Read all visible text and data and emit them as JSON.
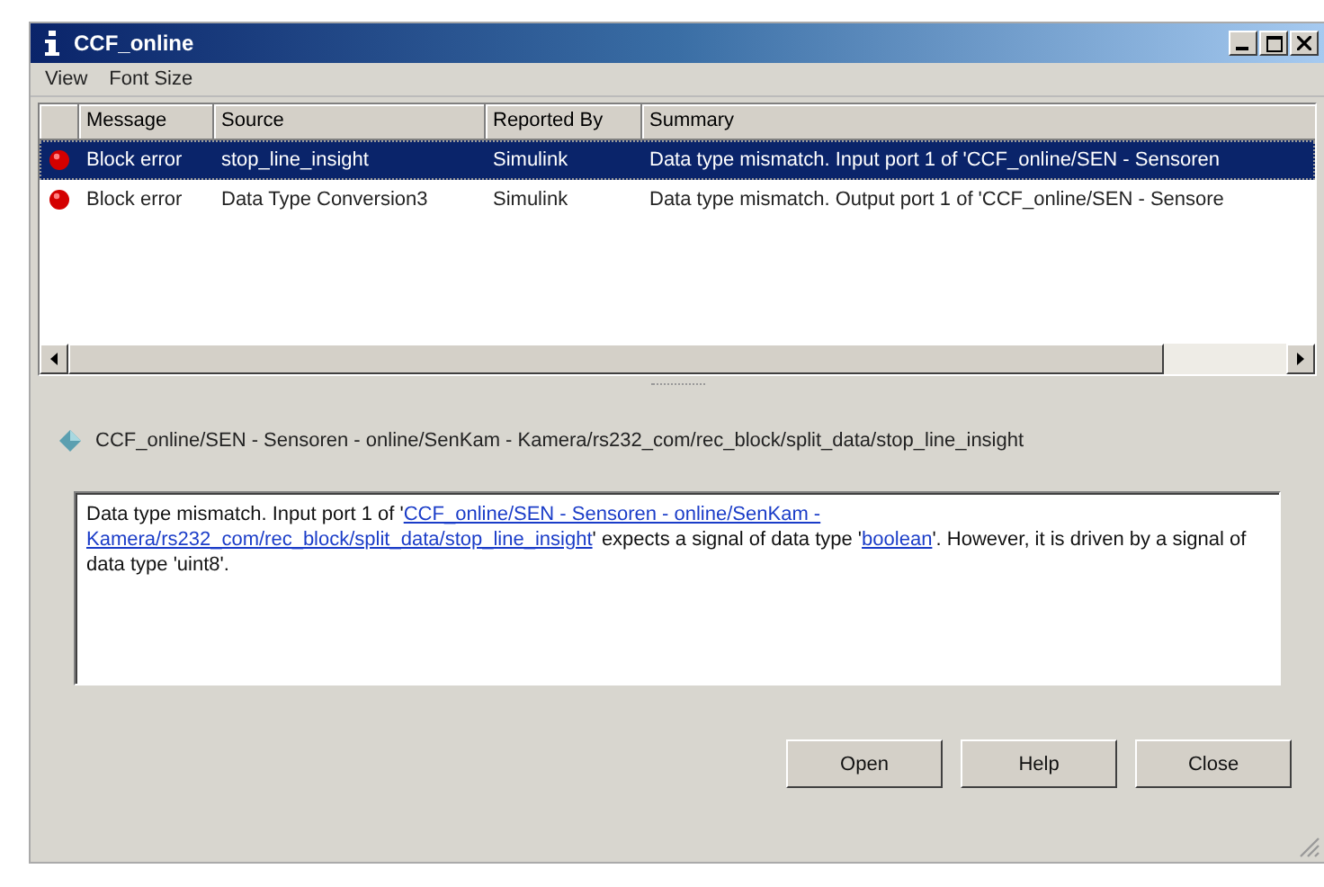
{
  "window": {
    "title": "CCF_online"
  },
  "menu": [
    "View",
    "Font Size"
  ],
  "table": {
    "columns": [
      "Message",
      "Source",
      "Reported By",
      "Summary"
    ],
    "rows": [
      {
        "selected": true,
        "cells": [
          "Block error",
          "stop_line_insight",
          "Simulink",
          "Data type mismatch. Input port 1 of 'CCF_online/SEN - Sensoren"
        ]
      },
      {
        "selected": false,
        "cells": [
          "Block error",
          "Data Type Conversion3",
          "Simulink",
          "Data type mismatch. Output port 1 of 'CCF_online/SEN - Sensore"
        ]
      }
    ]
  },
  "path": "CCF_online/SEN - Sensoren - online/SenKam - Kamera/rs232_com/rec_block/split_data/stop_line_insight",
  "message": [
    {
      "kind": "text",
      "text": "Data type mismatch. Input port 1 of '"
    },
    {
      "kind": "link",
      "text": "CCF_online/SEN - Sensoren - online/SenKam -"
    },
    {
      "kind": "link",
      "text": "Kamera/rs232_com/rec_block/split_data/stop_line_insight"
    },
    {
      "kind": "text",
      "text": "' expects a signal of data type '"
    },
    {
      "kind": "link",
      "text": "boolean"
    },
    {
      "kind": "text",
      "text": "'. However, it is driven by a signal of data type 'uint8'."
    }
  ],
  "buttons": [
    "Open",
    "Help",
    "Close"
  ]
}
